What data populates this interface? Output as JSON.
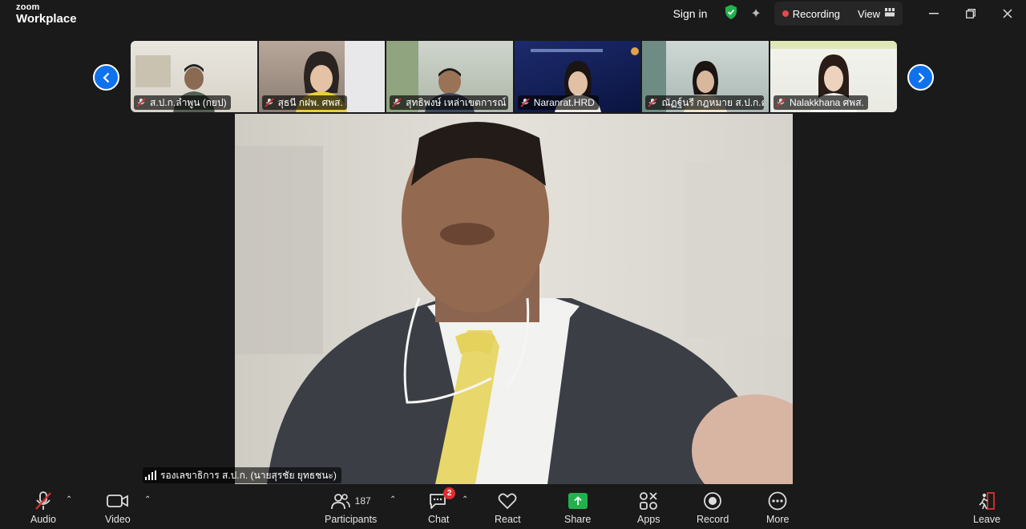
{
  "app": {
    "brand_small": "zoom",
    "brand_name": "Workplace"
  },
  "titlebar": {
    "sign_in": "Sign in",
    "recording": "Recording",
    "view": "View",
    "accent_green": "#23b14d",
    "recording_color": "#e5484d"
  },
  "gallery": {
    "tiles": [
      {
        "name": "ส.ป.ก.ลำพูน (กยป)",
        "muted": true
      },
      {
        "name": "สุธนี กฝพ. ศพส.",
        "muted": true
      },
      {
        "name": "สุทธิพงษ์ เหล่าเขตการณ์ ส...",
        "muted": true
      },
      {
        "name": "Naranrat.HRD",
        "muted": true
      },
      {
        "name": "ณัฏฐ์นรี กฎหมาย ส.ป.ก.ต...",
        "muted": true
      },
      {
        "name": "Nalakkhana ศพส.",
        "muted": true
      }
    ],
    "nav_color": "#0e72ed"
  },
  "main_video": {
    "speaker_name": "รองเลขาธิการ ส.ป.ก. (นายสุรชัย ยุทธชนะ)"
  },
  "toolbar": {
    "audio": "Audio",
    "video": "Video",
    "participants": "Participants",
    "participants_count": "187",
    "chat": "Chat",
    "chat_badge": "2",
    "react": "React",
    "share": "Share",
    "apps": "Apps",
    "record": "Record",
    "more": "More",
    "leave": "Leave"
  }
}
